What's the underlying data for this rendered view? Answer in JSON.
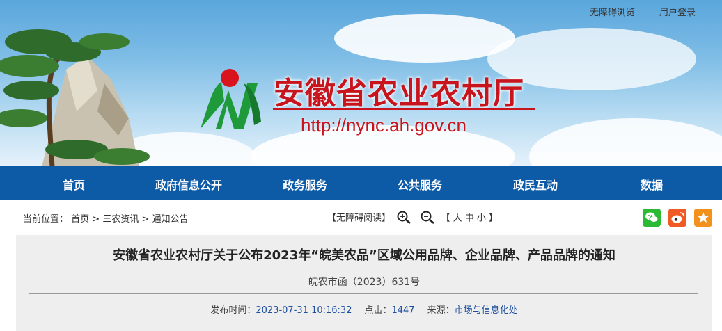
{
  "topbar": {
    "accessibility": "无障碍浏览",
    "login": "用户登录"
  },
  "header": {
    "title": "安徽省农业农村厅",
    "url": "http://nync.ah.gov.cn",
    "brand_red": "#c8141c"
  },
  "nav": {
    "items": [
      "首页",
      "政府信息公开",
      "政务服务",
      "公共服务",
      "政民互动",
      "数据"
    ],
    "bg_color": "#0d5aa7"
  },
  "breadcrumb": {
    "label": "当前位置：",
    "items": [
      "首页",
      "三农资讯",
      "通知公告"
    ],
    "separator": ">"
  },
  "tools": {
    "accessible_read": "【无障碍阅读】",
    "font_size": "【 大 中 小 】",
    "zoom_in_icon": "zoom-in-icon",
    "zoom_out_icon": "zoom-out-icon"
  },
  "share": {
    "icons": [
      "wechat-icon",
      "weibo-icon",
      "favorite-icon"
    ]
  },
  "article": {
    "title": "安徽省农业农村厅关于公布2023年“皖美农品”区域公用品牌、企业品牌、产品品牌的通知",
    "doc_number": "皖农市函（2023）631号",
    "publish_label": "发布时间：",
    "publish_time": "2023-07-31 10:16:32",
    "clicks_label": "点击：",
    "clicks": "1447",
    "source_label": "来源：",
    "source": "市场与信息化处"
  }
}
